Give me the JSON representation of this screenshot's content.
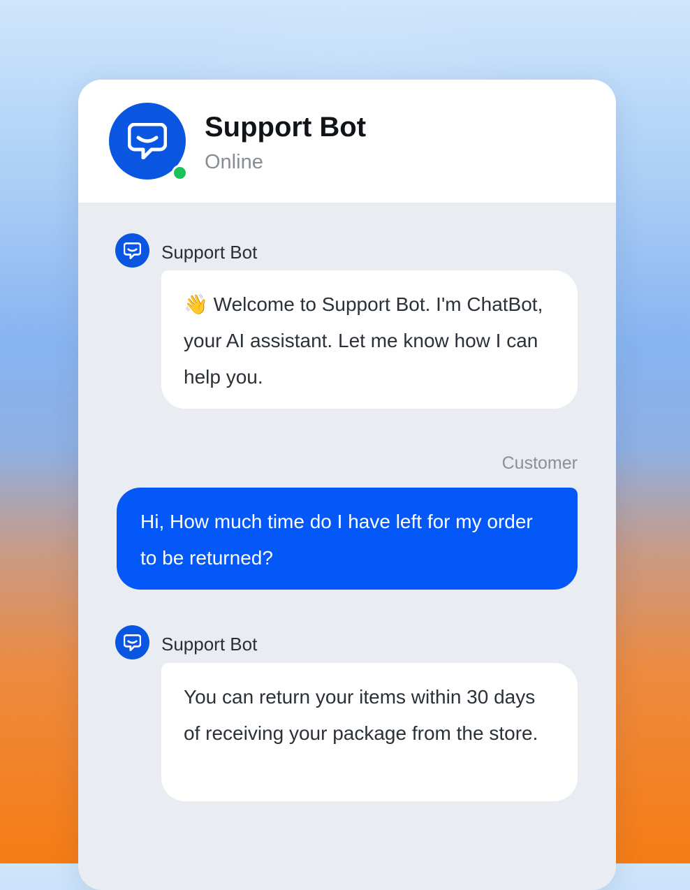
{
  "header": {
    "bot_name": "Support Bot",
    "status": "Online",
    "status_color": "#19c25a",
    "avatar_icon": "chat-bubble-icon"
  },
  "messages": [
    {
      "role": "bot",
      "sender": "Support Bot",
      "text": "👋 Welcome to Support Bot. I'm ChatBot, your AI assistant. Let me know how I can help you."
    },
    {
      "role": "customer",
      "sender": "Customer",
      "text": "Hi, How much time do I have left for my order to be returned?"
    },
    {
      "role": "bot",
      "sender": "Support Bot",
      "text": "You can return your items within 30 days of receiving your package from the store."
    }
  ],
  "colors": {
    "brand": "#0a56e0",
    "user_bubble": "#0558f8",
    "chat_background": "#e9edf2"
  }
}
